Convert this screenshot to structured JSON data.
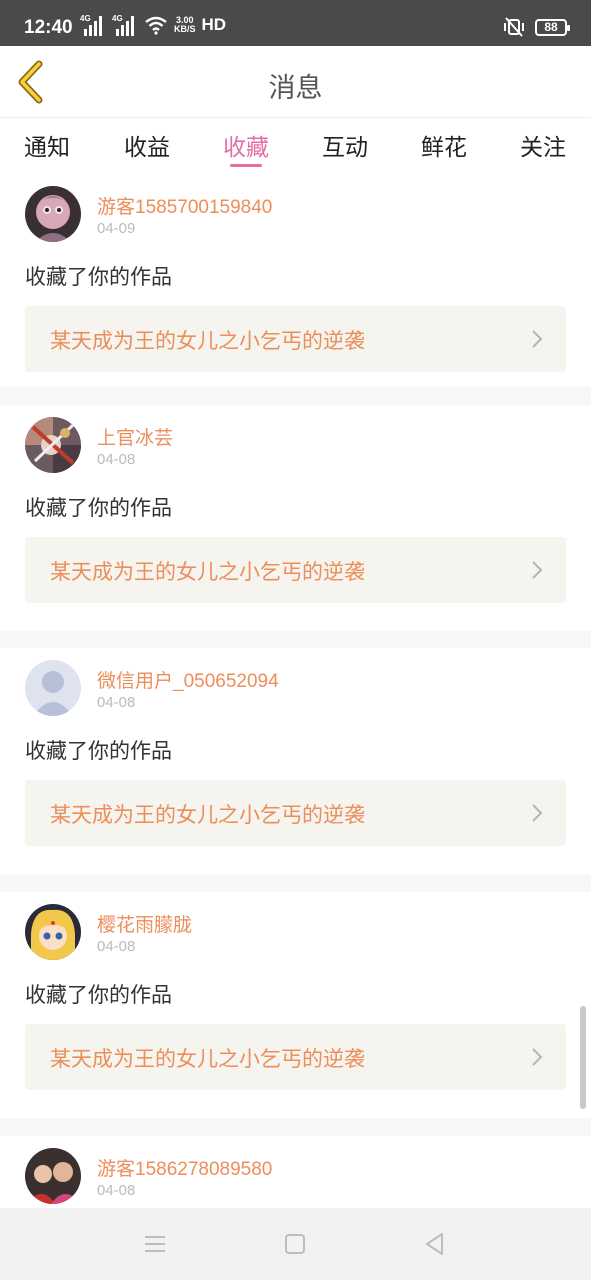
{
  "status_bar": {
    "time": "12:40",
    "network_1": "4G",
    "network_2": "4G",
    "speed_value": "3.00",
    "speed_unit": "KB/S",
    "hd": "HD",
    "battery": "88"
  },
  "header": {
    "title": "消息"
  },
  "tabs": [
    {
      "label": "通知",
      "active": false
    },
    {
      "label": "收益",
      "active": false
    },
    {
      "label": "收藏",
      "active": true
    },
    {
      "label": "互动",
      "active": false
    },
    {
      "label": "鲜花",
      "active": false
    },
    {
      "label": "关注",
      "active": false
    }
  ],
  "messages": [
    {
      "user": "游客1585700159840",
      "date": "04-09",
      "action": "收藏了你的作品",
      "work": "某天成为王的女儿之小乞丐的逆袭",
      "avatar": "anime-girl-pink-avatar"
    },
    {
      "user": "上官冰芸",
      "date": "04-08",
      "action": "收藏了你的作品",
      "work": "某天成为王的女儿之小乞丐的逆袭",
      "avatar": "anime-collage-avatar"
    },
    {
      "user": "微信用户_050652094",
      "date": "04-08",
      "action": "收藏了你的作品",
      "work": "某天成为王的女儿之小乞丐的逆袭",
      "avatar": "default-user-avatar"
    },
    {
      "user": "樱花雨朦胧",
      "date": "04-08",
      "action": "收藏了你的作品",
      "work": "某天成为王的女儿之小乞丐的逆袭",
      "avatar": "sailor-moon-avatar"
    },
    {
      "user": "游客1586278089580",
      "date": "04-08",
      "action": "",
      "work": "",
      "avatar": "photo-avatar"
    }
  ],
  "colors": {
    "accent": "#e36fa6",
    "name": "#ec8e5a",
    "work_bg": "#f5f4ef"
  }
}
